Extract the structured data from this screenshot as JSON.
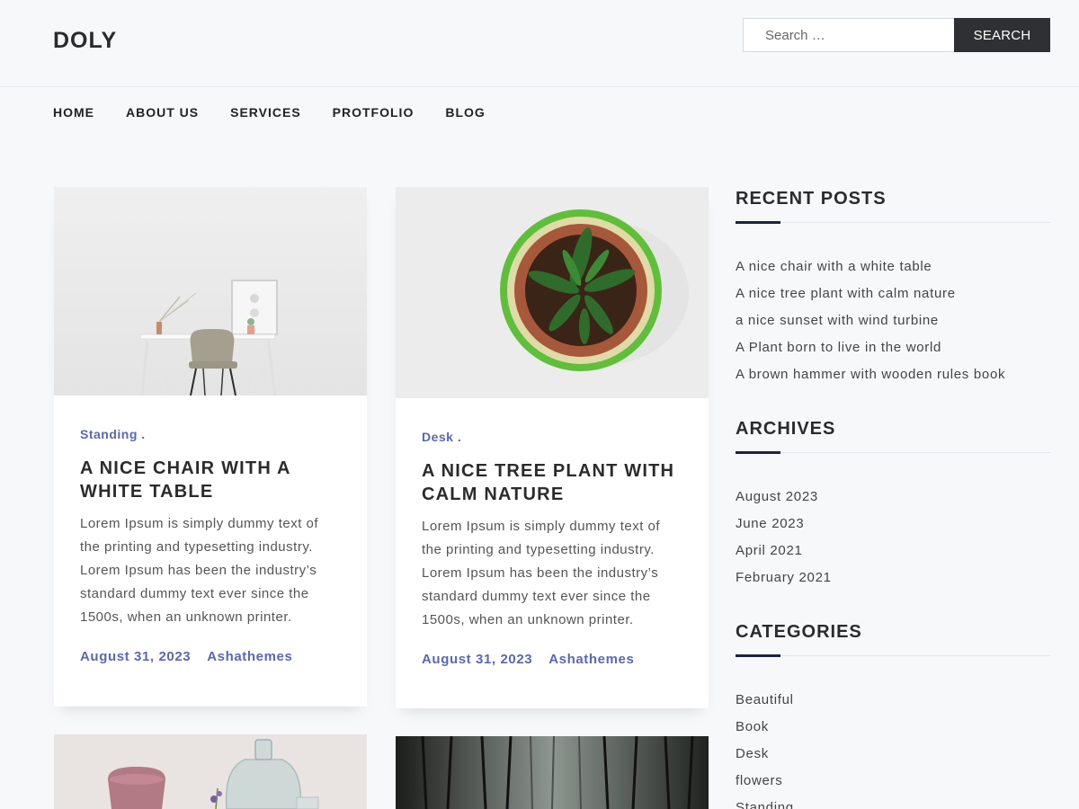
{
  "header": {
    "logo": "DOLY",
    "search_placeholder": "Search …",
    "search_button": "SEARCH"
  },
  "nav": {
    "items": [
      "HOME",
      "ABOUT US",
      "SERVICES",
      "PROTFOLIO",
      "BLOG"
    ]
  },
  "posts": [
    {
      "category": "Standing .",
      "title": "A NICE CHAIR WITH A WHITE TABLE",
      "excerpt": "Lorem Ipsum is simply dummy text of the printing and typesetting industry. Lorem Ipsum has been the industry’s standard dummy text ever since the 1500s, when an unknown printer.",
      "date": "August 31, 2023",
      "author": "Ashathemes"
    },
    {
      "category": "Desk .",
      "title": "A NICE TREE PLANT WITH CALM NATURE",
      "excerpt": "Lorem Ipsum is simply dummy text of the printing and typesetting industry. Lorem Ipsum has been the industry’s standard dummy text ever since the 1500s, when an unknown printer.",
      "date": "August 31, 2023",
      "author": "Ashathemes"
    }
  ],
  "sidebar": {
    "recent_posts": {
      "title": "RECENT POSTS",
      "items": [
        "A nice chair with a white table",
        "A nice tree plant with calm nature",
        "a nice sunset with wind turbine",
        "A Plant born to live in the world",
        "A brown hammer with wooden rules book"
      ]
    },
    "archives": {
      "title": "ARCHIVES",
      "items": [
        "August 2023",
        "June 2023",
        "April 2021",
        "February 2021"
      ]
    },
    "categories": {
      "title": "CATEGORIES",
      "items": [
        "Beautiful",
        "Book",
        "Desk",
        "flowers",
        "Standing"
      ]
    }
  },
  "colors": {
    "accent": "#5a67b8",
    "dark_button": "#2f3033",
    "page_background": "#f7f8fa"
  }
}
